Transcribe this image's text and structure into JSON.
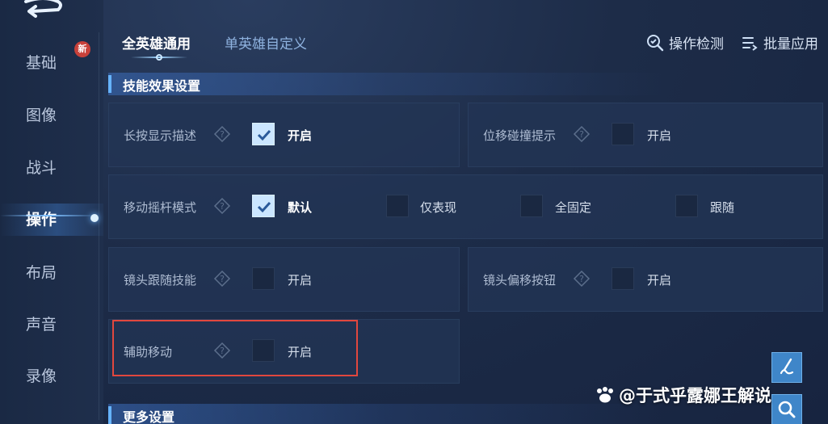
{
  "sidebar": {
    "items": [
      {
        "label": "基础"
      },
      {
        "label": "图像"
      },
      {
        "label": "战斗"
      },
      {
        "label": "操作"
      },
      {
        "label": "布局"
      },
      {
        "label": "声音"
      },
      {
        "label": "录像"
      }
    ],
    "active_index": 3,
    "new_badge": "新"
  },
  "tabs": [
    {
      "label": "全英雄通用",
      "active": true
    },
    {
      "label": "单英雄自定义",
      "active": false
    }
  ],
  "top_actions": {
    "check": "操作检测",
    "batch": "批量应用"
  },
  "sections": {
    "skill_effects": "技能效果设置",
    "more": "更多设置"
  },
  "settings": {
    "long_press": {
      "label": "长按显示描述",
      "option": "开启",
      "checked": true
    },
    "displacement": {
      "label": "位移碰撞提示",
      "option": "开启",
      "checked": false
    },
    "joystick": {
      "label": "移动摇杆模式",
      "options": [
        {
          "label": "默认",
          "checked": true
        },
        {
          "label": "仅表现",
          "checked": false
        },
        {
          "label": "全固定",
          "checked": false
        },
        {
          "label": "跟随",
          "checked": false
        }
      ]
    },
    "camera_follow": {
      "label": "镜头跟随技能",
      "option": "开启",
      "checked": false
    },
    "camera_offset": {
      "label": "镜头偏移按钮",
      "option": "开启",
      "checked": false
    },
    "assist_move": {
      "label": "辅助移动",
      "option": "开启",
      "checked": false
    }
  },
  "watermark": "@于式乎露娜王解说",
  "colors": {
    "accent": "#66b3ff",
    "highlight_border": "#e1473e",
    "checked_fill": "#cbe6ff"
  }
}
